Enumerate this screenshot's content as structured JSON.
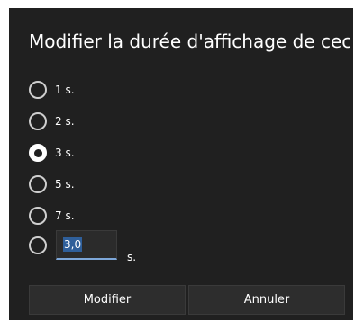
{
  "dialog": {
    "title": "Modifier la durée d'affichage de ceci",
    "options": [
      {
        "label": "1 s.",
        "selected": false
      },
      {
        "label": "2 s.",
        "selected": false
      },
      {
        "label": "3 s.",
        "selected": true
      },
      {
        "label": "5 s.",
        "selected": false
      },
      {
        "label": "7 s.",
        "selected": false
      }
    ],
    "custom": {
      "selected": false,
      "value": "3,0",
      "unit": "s."
    },
    "buttons": {
      "confirm_label": "Modifier",
      "cancel_label": "Annuler"
    }
  },
  "colors": {
    "dialog_background": "#202020",
    "accent": "#7da7d9",
    "text": "#ffffff"
  }
}
